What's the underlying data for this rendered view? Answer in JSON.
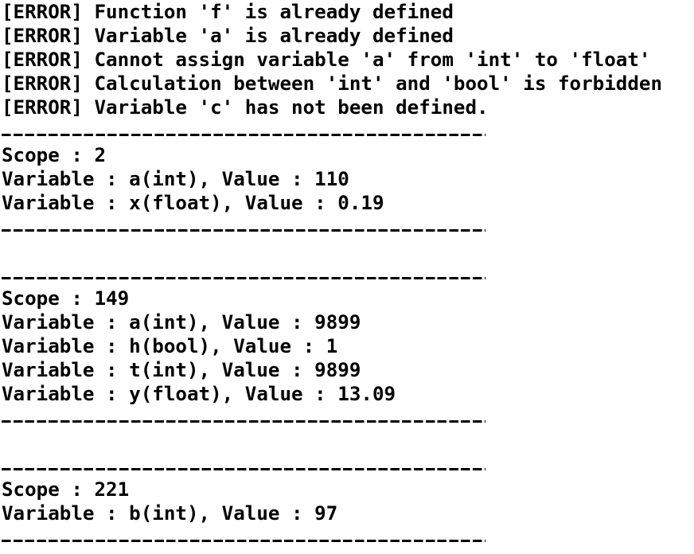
{
  "errors": [
    "[ERROR] Function 'f' is already defined",
    "[ERROR] Variable 'a' is already defined",
    "[ERROR] Cannot assign variable 'a' from 'int' to 'float'",
    "[ERROR] Calculation between 'int' and 'bool' is forbidden",
    "[ERROR] Variable 'c' has not been defined."
  ],
  "separator": "-----------------------------------------",
  "scopes": [
    {
      "header": "Scope : 2",
      "variables": [
        "Variable : a(int), Value : 110",
        "Variable : x(float), Value : 0.19"
      ]
    },
    {
      "header": "Scope : 149",
      "variables": [
        "Variable : a(int), Value : 9899",
        "Variable : h(bool), Value : 1",
        "Variable : t(int), Value : 9899",
        "Variable : y(float), Value : 13.09"
      ]
    },
    {
      "header": "Scope : 221",
      "variables": [
        "Variable : b(int), Value : 97"
      ]
    }
  ]
}
